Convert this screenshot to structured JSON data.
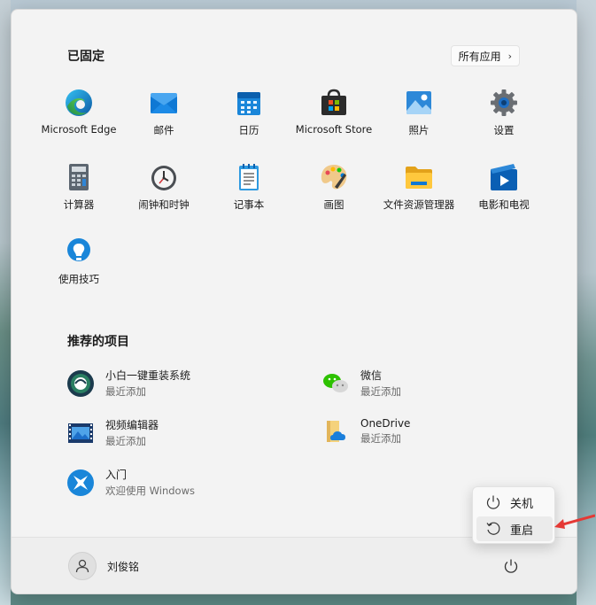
{
  "pinned": {
    "title": "已固定",
    "all_apps_label": "所有应用",
    "apps": [
      {
        "label": "Microsoft Edge",
        "icon": "edge-icon"
      },
      {
        "label": "邮件",
        "icon": "mail-icon"
      },
      {
        "label": "日历",
        "icon": "calendar-icon"
      },
      {
        "label": "Microsoft Store",
        "icon": "store-icon"
      },
      {
        "label": "照片",
        "icon": "photos-icon"
      },
      {
        "label": "设置",
        "icon": "gear-icon"
      },
      {
        "label": "计算器",
        "icon": "calculator-icon"
      },
      {
        "label": "闹钟和时钟",
        "icon": "clock-icon"
      },
      {
        "label": "记事本",
        "icon": "notepad-icon"
      },
      {
        "label": "画图",
        "icon": "paint-icon"
      },
      {
        "label": "文件资源管理器",
        "icon": "folder-icon"
      },
      {
        "label": "电影和电视",
        "icon": "movies-icon"
      },
      {
        "label": "使用技巧",
        "icon": "tips-icon"
      }
    ]
  },
  "recommended": {
    "title": "推荐的项目",
    "items": [
      {
        "name": "小白一键重装系统",
        "sub": "最近添加",
        "icon": "xiaobai-icon"
      },
      {
        "name": "微信",
        "sub": "最近添加",
        "icon": "wechat-icon"
      },
      {
        "name": "视频编辑器",
        "sub": "最近添加",
        "icon": "video-editor-icon"
      },
      {
        "name": "OneDrive",
        "sub": "最近添加",
        "icon": "onedrive-icon"
      },
      {
        "name": "入门",
        "sub": "欢迎使用 Windows",
        "icon": "get-started-icon"
      }
    ]
  },
  "user": {
    "name": "刘俊铭"
  },
  "power_menu": {
    "shutdown": "关机",
    "restart": "重启"
  },
  "colors": {
    "accent": "#0067c0",
    "arrow": "#e53935"
  }
}
